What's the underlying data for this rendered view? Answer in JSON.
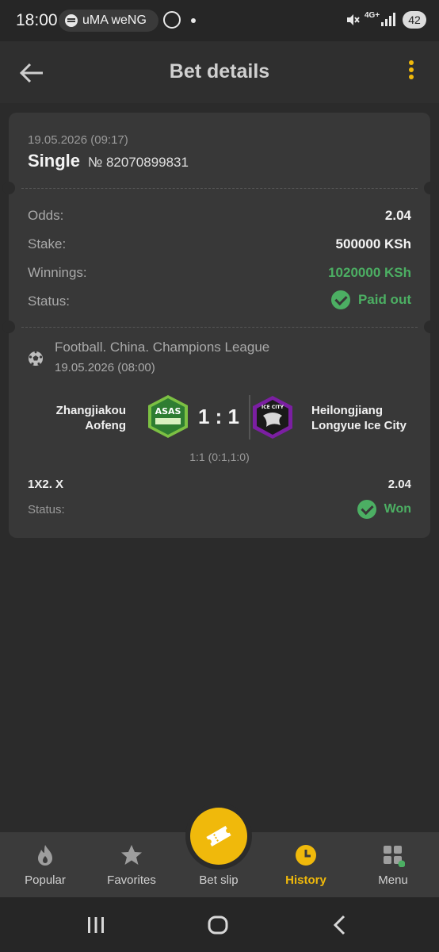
{
  "status_bar": {
    "time": "18:00",
    "media_pill": "uMA weNG",
    "network": "4G+",
    "battery": "42"
  },
  "header": {
    "title": "Bet details",
    "back_icon": "arrow-left-icon",
    "more_icon": "more-vertical-icon"
  },
  "bet": {
    "date": "19.05.2026 (09:17)",
    "type": "Single",
    "number": "№ 82070899831",
    "odds_label": "Odds:",
    "odds_value": "2.04",
    "stake_label": "Stake:",
    "stake_value": "500000 KSh",
    "winnings_label": "Winnings:",
    "winnings_value": "1020000 KSh",
    "status_label": "Status:",
    "status_value": "Paid out"
  },
  "event": {
    "league": "Football. China. Champions League",
    "date": "19.05.2026 (08:00)",
    "home_team": "Zhangjiakou Aofeng",
    "away_team": "Heilongjiang Longyue Ice City",
    "home_logo_text": "ASAS",
    "away_logo_text": "ICE CITY",
    "score": "1 : 1",
    "halves": "1:1 (0:1,1:0)",
    "market": "1X2. X",
    "market_odds": "2.04",
    "status_label": "Status:",
    "status_value": "Won"
  },
  "bottom_nav": {
    "items": [
      {
        "label": "Popular",
        "icon": "flame-icon"
      },
      {
        "label": "Favorites",
        "icon": "star-icon"
      },
      {
        "label": "Bet slip",
        "icon": "ticket-icon"
      },
      {
        "label": "History",
        "icon": "clock-icon",
        "active": true
      },
      {
        "label": "Menu",
        "icon": "grid-menu-icon"
      }
    ]
  },
  "colors": {
    "accent": "#f0b90b",
    "success": "#4caf63",
    "background": "#2b2b2b",
    "card": "#383838"
  }
}
